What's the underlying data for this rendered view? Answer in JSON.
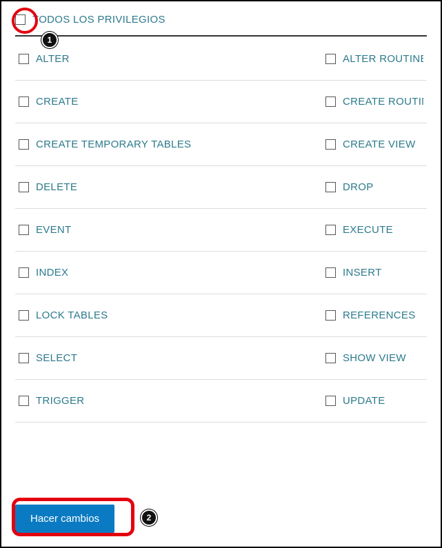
{
  "header": {
    "all_privileges_label": "TODOS LOS PRIVILEGIOS"
  },
  "privileges": [
    {
      "left": "ALTER",
      "right": "ALTER ROUTINE"
    },
    {
      "left": "CREATE",
      "right": "CREATE ROUTIN"
    },
    {
      "left": "CREATE TEMPORARY TABLES",
      "right": "CREATE VIEW"
    },
    {
      "left": "DELETE",
      "right": "DROP"
    },
    {
      "left": "EVENT",
      "right": "EXECUTE"
    },
    {
      "left": "INDEX",
      "right": "INSERT"
    },
    {
      "left": "LOCK TABLES",
      "right": "REFERENCES"
    },
    {
      "left": "SELECT",
      "right": "SHOW VIEW"
    },
    {
      "left": "TRIGGER",
      "right": "UPDATE"
    }
  ],
  "footer": {
    "submit_label": "Hacer cambios"
  },
  "annotations": {
    "badge1": "1",
    "badge2": "2"
  }
}
